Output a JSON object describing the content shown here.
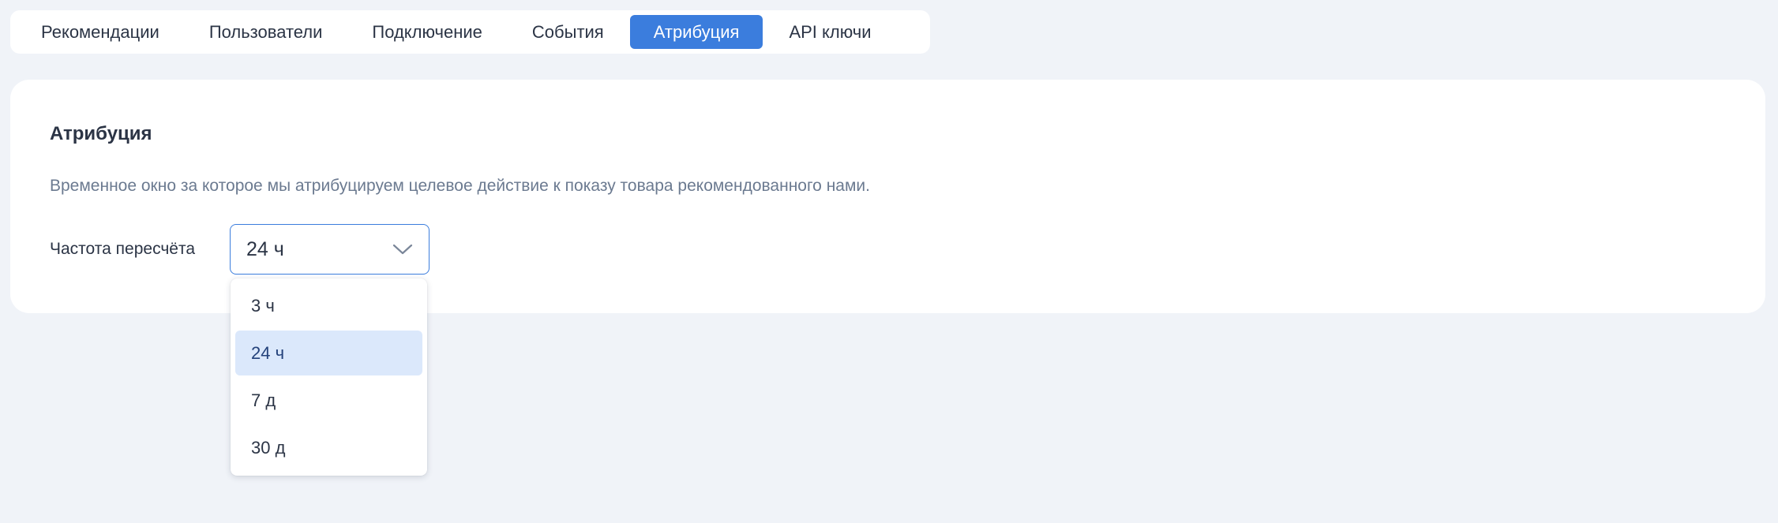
{
  "tabs": [
    {
      "label": "Рекомендации",
      "active": false
    },
    {
      "label": "Пользователи",
      "active": false
    },
    {
      "label": "Подключение",
      "active": false
    },
    {
      "label": "События",
      "active": false
    },
    {
      "label": "Атрибуция",
      "active": true
    },
    {
      "label": "API ключи",
      "active": false
    }
  ],
  "card": {
    "title": "Атрибуция",
    "description": "Временное окно за которое мы атрибуцируем целевое действие к показу товара рекомендованного нами."
  },
  "field": {
    "label": "Частота пересчёта",
    "selected_value": "24 ч",
    "options": [
      "3 ч",
      "24 ч",
      "7 д",
      "30 д"
    ],
    "selected_index": 1
  },
  "colors": {
    "accent": "#3b7ddd",
    "option_highlight": "#dbe8fb",
    "background": "#f0f3f8"
  },
  "icons": {
    "select_chevron": "chevron-down-icon"
  }
}
